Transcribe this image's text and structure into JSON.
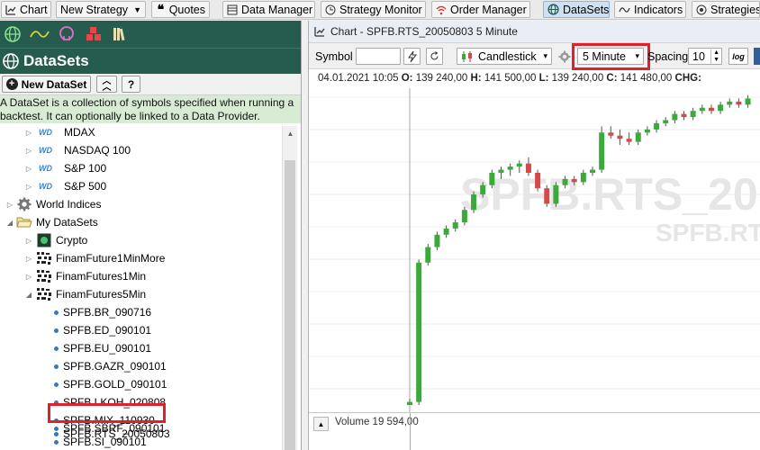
{
  "toolbar": {
    "items": [
      {
        "label": "Chart",
        "icon": "chart-icon"
      },
      {
        "label": "New Strategy",
        "icon": null
      },
      {
        "label": "Quotes",
        "icon": "quotes-icon"
      },
      {
        "label": "Data Manager",
        "icon": "data-manager-icon"
      },
      {
        "label": "Strategy Monitor",
        "icon": "strategy-monitor-icon"
      },
      {
        "label": "Order Manager",
        "icon": "wifi-icon"
      },
      {
        "label": "DataSets",
        "icon": "globe-icon"
      },
      {
        "label": "Indicators",
        "icon": "wave-icon"
      },
      {
        "label": "Strategies",
        "icon": "strategies-icon"
      }
    ]
  },
  "left_panel": {
    "title": "DataSets",
    "new_dataset_label": "New DataSet",
    "collapse_label": "⌃",
    "help_label": "?",
    "description_line1": "A DataSet is a collection of symbols specified when running a",
    "description_line2": "backtest. It can optionally be linked to a Data Provider.",
    "wd_badge": "WD",
    "tree": [
      {
        "label": "MDAX",
        "kind": "wd"
      },
      {
        "label": "NASDAQ 100",
        "kind": "wd"
      },
      {
        "label": "S&P 100",
        "kind": "wd"
      },
      {
        "label": "S&P 500",
        "kind": "wd"
      },
      {
        "label": "World Indices",
        "kind": "gear"
      },
      {
        "label": "My DataSets",
        "kind": "folder"
      },
      {
        "label": "Crypto",
        "kind": "crypto"
      },
      {
        "label": "FinamFuture1MinMore",
        "kind": "finam"
      },
      {
        "label": "FinamFutures1Min",
        "kind": "finam"
      },
      {
        "label": "FinamFutures5Min",
        "kind": "finam"
      },
      {
        "label": "SPFB.BR_090716",
        "kind": "symbol"
      },
      {
        "label": "SPFB.ED_090101",
        "kind": "symbol"
      },
      {
        "label": "SPFB.EU_090101",
        "kind": "symbol"
      },
      {
        "label": "SPFB.GAZR_090101",
        "kind": "symbol"
      },
      {
        "label": "SPFB.GOLD_090101",
        "kind": "symbol"
      },
      {
        "label": "SPFB.LKOH_020808",
        "kind": "symbol"
      },
      {
        "label": "SPFB.MIX_110930",
        "kind": "symbol"
      },
      {
        "label": "SPFB.RTS_20050803",
        "kind": "symbol",
        "selected": true
      },
      {
        "label": "SPFB.SBRF_090101",
        "kind": "symbol"
      },
      {
        "label": "SPFB.SI_090101",
        "kind": "symbol"
      }
    ]
  },
  "chart": {
    "window_title": "Chart - SPFB.RTS_20050803 5 Minute",
    "symbol_label": "Symbol",
    "symbol_value": "",
    "chart_type": "Candlestick",
    "interval": "5 Minute",
    "spacing_label": "Spacing",
    "spacing_value": "10",
    "log_label": "log",
    "info": {
      "date": "04.01.2021 10:05",
      "open_label": "O:",
      "open": "139 240,00",
      "high_label": "H:",
      "high": "141 500,00",
      "low_label": "L:",
      "low": "139 240,00",
      "close_label": "C:",
      "close": "141 480,00",
      "chg_label": "CHG:"
    },
    "watermark_main": "SPFB.RTS_20",
    "watermark_sub": "SPFB.RTS",
    "volume_label": "Volume 19 594,00",
    "colors": {
      "up": "#3aaa3a",
      "down": "#d44a4a",
      "accent": "#e0202a"
    }
  },
  "chart_data": {
    "type": "candlestick",
    "candles": [
      {
        "o": 0.0,
        "h": 0.02,
        "l": 0.0,
        "c": 0.01
      },
      {
        "o": 0.01,
        "h": 0.47,
        "l": 0.0,
        "c": 0.46
      },
      {
        "o": 0.46,
        "h": 0.52,
        "l": 0.45,
        "c": 0.51
      },
      {
        "o": 0.51,
        "h": 0.56,
        "l": 0.5,
        "c": 0.55
      },
      {
        "o": 0.55,
        "h": 0.58,
        "l": 0.54,
        "c": 0.57
      },
      {
        "o": 0.57,
        "h": 0.6,
        "l": 0.56,
        "c": 0.59
      },
      {
        "o": 0.59,
        "h": 0.64,
        "l": 0.58,
        "c": 0.63
      },
      {
        "o": 0.63,
        "h": 0.69,
        "l": 0.62,
        "c": 0.68
      },
      {
        "o": 0.68,
        "h": 0.72,
        "l": 0.67,
        "c": 0.71
      },
      {
        "o": 0.71,
        "h": 0.76,
        "l": 0.7,
        "c": 0.75
      },
      {
        "o": 0.75,
        "h": 0.77,
        "l": 0.73,
        "c": 0.76
      },
      {
        "o": 0.76,
        "h": 0.78,
        "l": 0.74,
        "c": 0.77
      },
      {
        "o": 0.77,
        "h": 0.79,
        "l": 0.75,
        "c": 0.78
      },
      {
        "o": 0.78,
        "h": 0.8,
        "l": 0.74,
        "c": 0.75
      },
      {
        "o": 0.75,
        "h": 0.76,
        "l": 0.69,
        "c": 0.7
      },
      {
        "o": 0.7,
        "h": 0.71,
        "l": 0.64,
        "c": 0.65
      },
      {
        "o": 0.65,
        "h": 0.72,
        "l": 0.64,
        "c": 0.71
      },
      {
        "o": 0.71,
        "h": 0.74,
        "l": 0.7,
        "c": 0.73
      },
      {
        "o": 0.73,
        "h": 0.74,
        "l": 0.71,
        "c": 0.72
      },
      {
        "o": 0.72,
        "h": 0.76,
        "l": 0.71,
        "c": 0.75
      },
      {
        "o": 0.75,
        "h": 0.77,
        "l": 0.74,
        "c": 0.76
      },
      {
        "o": 0.76,
        "h": 0.9,
        "l": 0.75,
        "c": 0.88
      },
      {
        "o": 0.88,
        "h": 0.9,
        "l": 0.86,
        "c": 0.87
      },
      {
        "o": 0.87,
        "h": 0.89,
        "l": 0.84,
        "c": 0.86
      },
      {
        "o": 0.86,
        "h": 0.88,
        "l": 0.84,
        "c": 0.85
      },
      {
        "o": 0.85,
        "h": 0.89,
        "l": 0.84,
        "c": 0.88
      },
      {
        "o": 0.88,
        "h": 0.9,
        "l": 0.87,
        "c": 0.89
      },
      {
        "o": 0.89,
        "h": 0.92,
        "l": 0.88,
        "c": 0.91
      },
      {
        "o": 0.91,
        "h": 0.93,
        "l": 0.9,
        "c": 0.92
      },
      {
        "o": 0.92,
        "h": 0.95,
        "l": 0.91,
        "c": 0.94
      },
      {
        "o": 0.94,
        "h": 0.95,
        "l": 0.92,
        "c": 0.93
      },
      {
        "o": 0.93,
        "h": 0.96,
        "l": 0.92,
        "c": 0.95
      },
      {
        "o": 0.95,
        "h": 0.97,
        "l": 0.94,
        "c": 0.96
      },
      {
        "o": 0.96,
        "h": 0.97,
        "l": 0.94,
        "c": 0.95
      },
      {
        "o": 0.95,
        "h": 0.98,
        "l": 0.94,
        "c": 0.97
      },
      {
        "o": 0.97,
        "h": 0.99,
        "l": 0.96,
        "c": 0.98
      },
      {
        "o": 0.98,
        "h": 0.99,
        "l": 0.96,
        "c": 0.97
      },
      {
        "o": 0.97,
        "h": 1.0,
        "l": 0.96,
        "c": 0.99
      }
    ]
  }
}
